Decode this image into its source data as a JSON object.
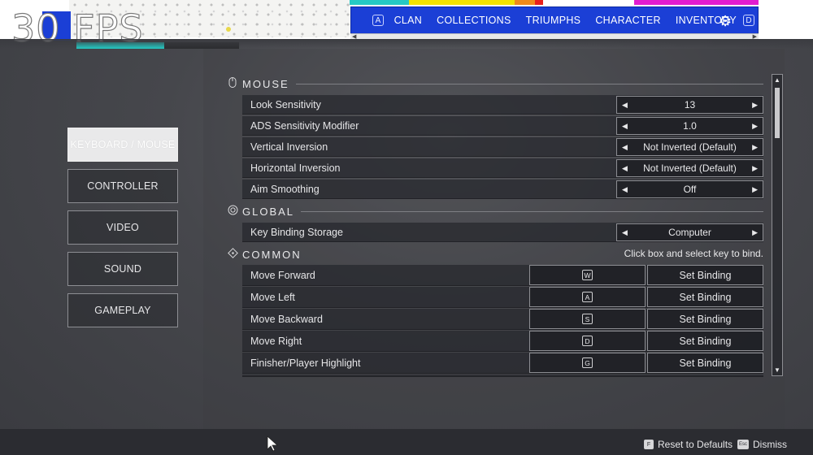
{
  "overlay": {
    "fps_text": "30 FPS",
    "fps_bar_fraction": 0.54,
    "accent_colors": {
      "cyan": "#25c9c4",
      "yellow": "#f2e200",
      "magenta": "#e11cd0",
      "red": "#e8201c",
      "orange": "#f08a1a",
      "nav_blue": "#1b3fd6"
    }
  },
  "topnav": {
    "left_key": "A",
    "items": [
      "CLAN",
      "COLLECTIONS",
      "TRIUMPHS",
      "CHARACTER",
      "INVENTORY"
    ],
    "settings_icon": "gear-icon",
    "right_key": "D"
  },
  "sidebar": {
    "items": [
      {
        "label": "KEYBOARD / MOUSE",
        "active": true
      },
      {
        "label": "CONTROLLER",
        "active": false
      },
      {
        "label": "VIDEO",
        "active": false
      },
      {
        "label": "SOUND",
        "active": false
      },
      {
        "label": "GAMEPLAY",
        "active": false
      }
    ]
  },
  "mouse": {
    "title": "MOUSE",
    "icon": "mouse-icon",
    "rows": [
      {
        "label": "Look Sensitivity",
        "value": "13"
      },
      {
        "label": "ADS Sensitivity Modifier",
        "value": "1.0"
      },
      {
        "label": "Vertical Inversion",
        "value": "Not Inverted (Default)"
      },
      {
        "label": "Horizontal Inversion",
        "value": "Not Inverted (Default)"
      },
      {
        "label": "Aim Smoothing",
        "value": "Off"
      }
    ]
  },
  "global": {
    "title": "GLOBAL",
    "icon": "globe-icon",
    "rows": [
      {
        "label": "Key Binding Storage",
        "value": "Computer"
      }
    ]
  },
  "common": {
    "title": "COMMON",
    "icon": "diamond-icon",
    "note": "Click box and select key to bind.",
    "rows": [
      {
        "label": "Move Forward",
        "key": "W",
        "binding": "Set Binding"
      },
      {
        "label": "Move Left",
        "key": "A",
        "binding": "Set Binding"
      },
      {
        "label": "Move Backward",
        "key": "S",
        "binding": "Set Binding"
      },
      {
        "label": "Move Right",
        "key": "D",
        "binding": "Set Binding"
      },
      {
        "label": "Finisher/Player Highlight",
        "key": "G",
        "binding": "Set Binding"
      }
    ]
  },
  "footer": {
    "reset_key": "F",
    "reset_label": "Reset to Defaults",
    "dismiss_key": "Esc",
    "dismiss_label": "Dismiss"
  }
}
